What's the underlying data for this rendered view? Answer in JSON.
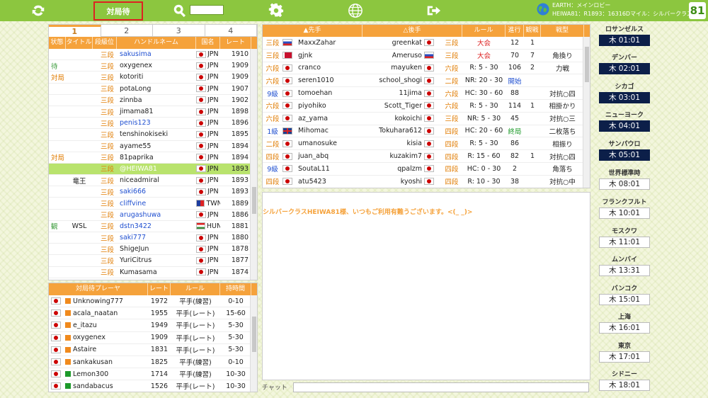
{
  "topbar": {
    "active_tab": "対局待",
    "info_line1": "EARTH：メインロビー",
    "info_line2": "HEIWA81：R1893：16316Dマイル：シルバークラス",
    "logo": "81"
  },
  "players": {
    "tabs": [
      "1",
      "2",
      "3",
      "4"
    ],
    "headers": [
      "状態",
      "タイトル",
      "段級位",
      "ハンドルネーム",
      "国名",
      "レート"
    ],
    "rows": [
      {
        "status": "",
        "title": "",
        "rank": "三段",
        "name": "sakusima",
        "country": "JPN",
        "rate": "1910",
        "flag": "jp",
        "link": true
      },
      {
        "status": "待",
        "title": "",
        "rank": "三段",
        "name": "oxygenex",
        "country": "JPN",
        "rate": "1909",
        "flag": "jp",
        "link": false
      },
      {
        "status": "対局",
        "title": "",
        "rank": "三段",
        "name": "kotoriti",
        "country": "JPN",
        "rate": "1909",
        "flag": "jp",
        "link": false
      },
      {
        "status": "",
        "title": "",
        "rank": "三段",
        "name": "potaLong",
        "country": "JPN",
        "rate": "1907",
        "flag": "jp",
        "link": false
      },
      {
        "status": "",
        "title": "",
        "rank": "三段",
        "name": "zinnba",
        "country": "JPN",
        "rate": "1902",
        "flag": "jp",
        "link": false
      },
      {
        "status": "",
        "title": "",
        "rank": "三段",
        "name": "jimama81",
        "country": "JPN",
        "rate": "1898",
        "flag": "jp",
        "link": false
      },
      {
        "status": "",
        "title": "",
        "rank": "三段",
        "name": "penis123",
        "country": "JPN",
        "rate": "1896",
        "flag": "jp",
        "link": true
      },
      {
        "status": "",
        "title": "",
        "rank": "三段",
        "name": "tenshinokiseki",
        "country": "JPN",
        "rate": "1895",
        "flag": "jp",
        "link": false
      },
      {
        "status": "",
        "title": "",
        "rank": "三段",
        "name": "ayame55",
        "country": "JPN",
        "rate": "1894",
        "flag": "jp",
        "link": false
      },
      {
        "status": "対局",
        "title": "",
        "rank": "三段",
        "name": "81paprika",
        "country": "JPN",
        "rate": "1894",
        "flag": "jp",
        "link": false
      },
      {
        "status": "",
        "title": "",
        "rank": "三段",
        "name": "@HEIWA81",
        "country": "JPN",
        "rate": "1893",
        "flag": "jp",
        "link": false,
        "selected": true
      },
      {
        "status": "",
        "title": "竜王",
        "rank": "三段",
        "name": "niceadmiral",
        "country": "JPN",
        "rate": "1893",
        "flag": "jp",
        "link": false
      },
      {
        "status": "",
        "title": "",
        "rank": "三段",
        "name": "saki666",
        "country": "JPN",
        "rate": "1893",
        "flag": "jp",
        "link": true
      },
      {
        "status": "",
        "title": "",
        "rank": "三段",
        "name": "cliffvine",
        "country": "TWN",
        "rate": "1889",
        "flag": "tw",
        "link": true
      },
      {
        "status": "",
        "title": "",
        "rank": "三段",
        "name": "arugashuwa",
        "country": "JPN",
        "rate": "1886",
        "flag": "jp",
        "link": true
      },
      {
        "status": "観",
        "title": "WSL",
        "rank": "三段",
        "name": "dstn3422",
        "country": "HUN",
        "rate": "1881",
        "flag": "hu",
        "link": true
      },
      {
        "status": "",
        "title": "",
        "rank": "三段",
        "name": "saki777",
        "country": "JPN",
        "rate": "1880",
        "flag": "jp",
        "link": true
      },
      {
        "status": "",
        "title": "",
        "rank": "三段",
        "name": "ShigeJun",
        "country": "JPN",
        "rate": "1878",
        "flag": "jp",
        "link": false
      },
      {
        "status": "",
        "title": "",
        "rank": "三段",
        "name": "YuriCitrus",
        "country": "JPN",
        "rate": "1877",
        "flag": "jp",
        "link": false
      },
      {
        "status": "",
        "title": "",
        "rank": "三段",
        "name": "Kumasama",
        "country": "JPN",
        "rate": "1874",
        "flag": "jp",
        "link": false
      }
    ]
  },
  "waiting": {
    "headers": [
      "対局待プレーヤ",
      "レート",
      "ルール",
      "持時間"
    ],
    "rows": [
      {
        "name": "Unknowing777",
        "rate": "1972",
        "rule": "平手(練習)",
        "time": "0-10",
        "color": "#f08a1d"
      },
      {
        "name": "acala_naatan",
        "rate": "1955",
        "rule": "平手(レート)",
        "time": "15-60",
        "color": "#f08a1d"
      },
      {
        "name": "e_itazu",
        "rate": "1949",
        "rule": "平手(レート)",
        "time": "5-30",
        "color": "#f08a1d"
      },
      {
        "name": "oxygenex",
        "rate": "1909",
        "rule": "平手(レート)",
        "time": "5-30",
        "color": "#f08a1d"
      },
      {
        "name": "Astaire",
        "rate": "1831",
        "rule": "平手(レート)",
        "time": "5-30",
        "color": "#f08a1d"
      },
      {
        "name": "sankakusan",
        "rate": "1825",
        "rule": "平手(練習)",
        "time": "0-10",
        "color": "#f08a1d"
      },
      {
        "name": "Lemon300",
        "rate": "1714",
        "rule": "平手(練習)",
        "time": "10-30",
        "color": "#1d9a2a"
      },
      {
        "name": "sandabacus",
        "rate": "1526",
        "rule": "平手(レート)",
        "time": "10-30",
        "color": "#1d9a2a"
      }
    ]
  },
  "games": {
    "headers": [
      "▲先手",
      "△後手",
      "ルール",
      "進行",
      "観戦",
      "戦型"
    ],
    "rows": [
      {
        "r1": "三段",
        "f1": "ru",
        "n1": "MaxxZahar",
        "n2": "greenkat",
        "f2": "jp",
        "r2": "三段",
        "rule": "大会",
        "ruleColor": "#d22",
        "move": "12",
        "moveColor": "#222",
        "watch": "1",
        "style": ""
      },
      {
        "r1": "三段",
        "f1": "by",
        "n1": "gjnk",
        "n2": "Ameruso",
        "f2": "ru",
        "r2": "三段",
        "rule": "大会",
        "ruleColor": "#d22",
        "move": "70",
        "moveColor": "#222",
        "watch": "7",
        "style": "角換り"
      },
      {
        "r1": "六段",
        "f1": "jp",
        "n1": "cranco",
        "n2": "mayuken",
        "f2": "jp",
        "r2": "六段",
        "rule": "R: 5 - 30",
        "ruleColor": "#222",
        "move": "106",
        "moveColor": "#222",
        "watch": "2",
        "style": "力戦"
      },
      {
        "r1": "六段",
        "f1": "jp",
        "n1": "seren1010",
        "n2": "school_shogi",
        "f2": "jp",
        "r2": "二段",
        "rule": "NR: 20 - 30",
        "ruleColor": "#222",
        "move": "開始",
        "moveColor": "#1f4fd0",
        "watch": "",
        "style": ""
      },
      {
        "r1": "9級",
        "f1": "jp",
        "n1": "tomoehan",
        "n2": "11jima",
        "f2": "jp",
        "r2": "六段",
        "rule": "HC: 30 - 60",
        "ruleColor": "#222",
        "move": "88",
        "moveColor": "#222",
        "watch": "",
        "style": "対抗○四"
      },
      {
        "r1": "六段",
        "f1": "jp",
        "n1": "piyohiko",
        "n2": "Scott_Tiger",
        "f2": "jp",
        "r2": "六段",
        "rule": "R: 5 - 30",
        "ruleColor": "#222",
        "move": "114",
        "moveColor": "#222",
        "watch": "1",
        "style": "相掛かり"
      },
      {
        "r1": "六段",
        "f1": "jp",
        "n1": "az_yama",
        "n2": "kokoichi",
        "f2": "jp",
        "r2": "三段",
        "rule": "NR: 5 - 30",
        "ruleColor": "#222",
        "move": "45",
        "moveColor": "#222",
        "watch": "",
        "style": "対抗○三"
      },
      {
        "r1": "1級",
        "f1": "gb",
        "n1": "Mihomac",
        "n2": "Tokuhara612",
        "f2": "jp",
        "r2": "四段",
        "rule": "HC: 20 - 60",
        "ruleColor": "#222",
        "move": "終局",
        "moveColor": "#1d9a2a",
        "watch": "",
        "style": "二枚落ち"
      },
      {
        "r1": "二段",
        "f1": "jp",
        "n1": "umanosuke",
        "n2": "kisia",
        "f2": "jp",
        "r2": "四段",
        "rule": "R: 5 - 30",
        "ruleColor": "#222",
        "move": "86",
        "moveColor": "#222",
        "watch": "",
        "style": "相振り"
      },
      {
        "r1": "四段",
        "f1": "jp",
        "n1": "juan_abq",
        "n2": "kuzakim7",
        "f2": "jp",
        "r2": "四段",
        "rule": "R: 15 - 60",
        "ruleColor": "#222",
        "move": "82",
        "moveColor": "#222",
        "watch": "1",
        "style": "対抗○四"
      },
      {
        "r1": "9級",
        "f1": "jp",
        "n1": "SoutaL11",
        "n2": "qpalzm",
        "f2": "jp",
        "r2": "四段",
        "rule": "HC: 0 - 30",
        "ruleColor": "#222",
        "move": "2",
        "moveColor": "#222",
        "watch": "",
        "style": "角落ち"
      },
      {
        "r1": "四段",
        "f1": "jp",
        "n1": "atu5423",
        "n2": "kyoshi",
        "f2": "jp",
        "r2": "四段",
        "rule": "R: 10 - 30",
        "ruleColor": "#222",
        "move": "38",
        "moveColor": "#222",
        "watch": "",
        "style": "対抗○中"
      }
    ]
  },
  "chat": {
    "message": "シルバークラスHEIWA81様、いつもご利用有難うございます。<(_ _)>",
    "label": "チャット"
  },
  "clocks": [
    {
      "city": "ロサンゼルス",
      "time": "木 01:01",
      "dark": true
    },
    {
      "city": "デンバー",
      "time": "木 02:01",
      "dark": true
    },
    {
      "city": "シカゴ",
      "time": "木 03:01",
      "dark": true
    },
    {
      "city": "ニューヨーク",
      "time": "木 04:01",
      "dark": true
    },
    {
      "city": "サンパウロ",
      "time": "木 05:01",
      "dark": true
    },
    {
      "city": "世界標準時",
      "time": "木 08:01",
      "dark": false
    },
    {
      "city": "フランクフルト",
      "time": "木 10:01",
      "dark": false
    },
    {
      "city": "モスクワ",
      "time": "木 11:01",
      "dark": false
    },
    {
      "city": "ムンバイ",
      "time": "木 13:31",
      "dark": false
    },
    {
      "city": "バンコク",
      "time": "木 15:01",
      "dark": false
    },
    {
      "city": "上海",
      "time": "木 16:01",
      "dark": false
    },
    {
      "city": "東京",
      "time": "木 17:01",
      "dark": false
    },
    {
      "city": "シドニー",
      "time": "木 18:01",
      "dark": false
    }
  ]
}
